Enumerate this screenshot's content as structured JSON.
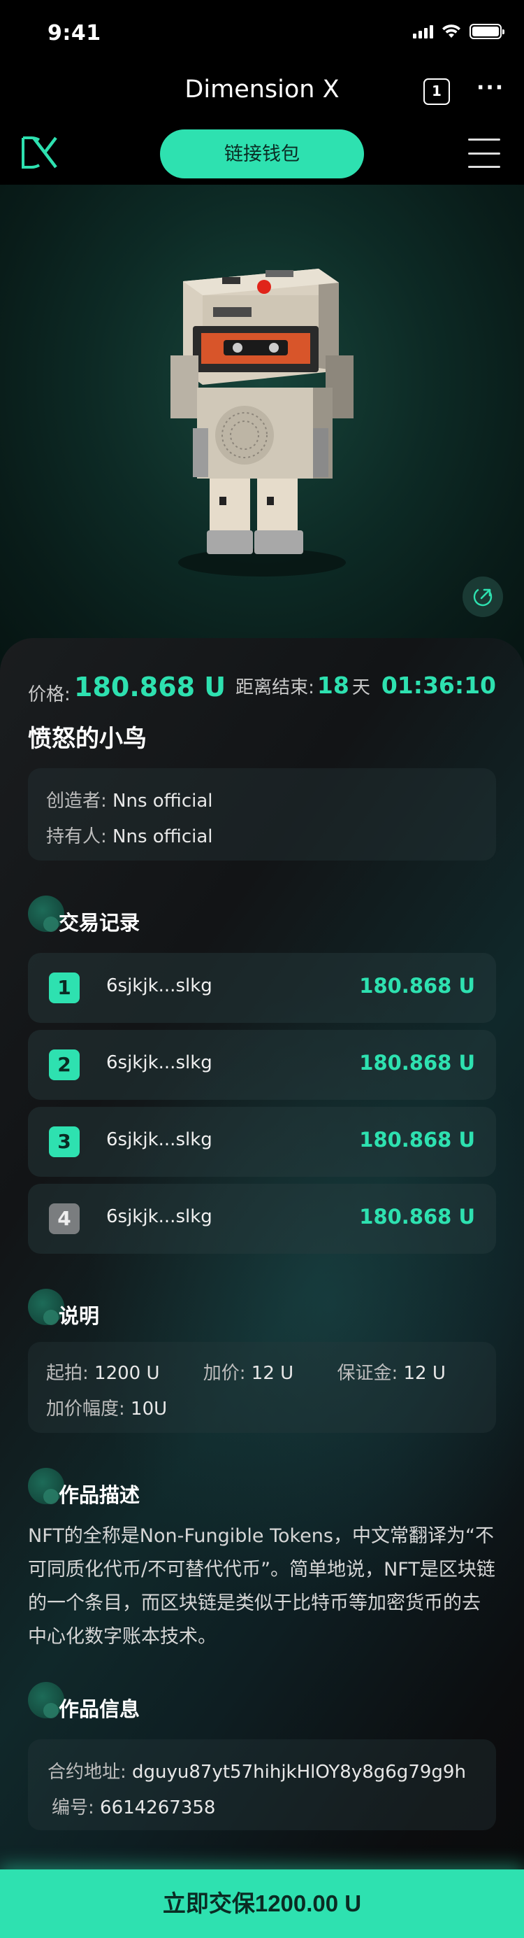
{
  "status_bar": {
    "time": "9:41"
  },
  "title_bar": {
    "title": "Dimension X",
    "tab_count": "1",
    "more": "···"
  },
  "nav": {
    "connect_label": "链接钱包"
  },
  "price": {
    "label": "价格:",
    "value": "180.868 U",
    "countdown_label": "距离结束:",
    "days": "18",
    "days_unit": "天",
    "time": "01:36:10"
  },
  "item": {
    "name": "愤怒的小鸟"
  },
  "owner_card": {
    "creator_label": "创造者:",
    "creator_value": "Nns official",
    "holder_label": "持有人:",
    "holder_value": "Nns official"
  },
  "sections": {
    "transactions": "交易记录",
    "notes": "说明",
    "description": "作品描述",
    "info": "作品信息"
  },
  "transactions": [
    {
      "rank": "1",
      "address": "6sjkjk...slkg",
      "amount": "180.868 U"
    },
    {
      "rank": "2",
      "address": "6sjkjk...slkg",
      "amount": "180.868 U"
    },
    {
      "rank": "3",
      "address": "6sjkjk...slkg",
      "amount": "180.868 U"
    },
    {
      "rank": "4",
      "address": "6sjkjk...slkg",
      "amount": "180.868 U"
    }
  ],
  "notes_card": {
    "start_label": "起拍:",
    "start_value": "1200 U",
    "raise_label": "加价:",
    "raise_value": "12 U",
    "deposit_label": "保证金:",
    "deposit_value": "12 U",
    "range_label": "加价幅度:",
    "range_value": "10U"
  },
  "description_text": "NFT的全称是Non-Fungible Tokens，中文常翻译为“不可同质化代币/不可替代代币”。简单地说，NFT是区块链的一个条目，而区块链是类似于比特币等加密货币的去中心化数字账本技术。",
  "info_card": {
    "contract_label": "合约地址:",
    "contract_value": "dguyu87yt57hihjkHlOY8y8g6g79g9h",
    "id_label": "编号:",
    "id_value": "6614267358"
  },
  "bottom_button": {
    "label": "立即交保1200.00 U"
  },
  "colors": {
    "accent": "#2ee1b0",
    "background": "#000000"
  },
  "icons": {
    "share": "share-arrow-icon",
    "menu": "hamburger-menu-icon",
    "logo": "dx-logo-icon"
  }
}
